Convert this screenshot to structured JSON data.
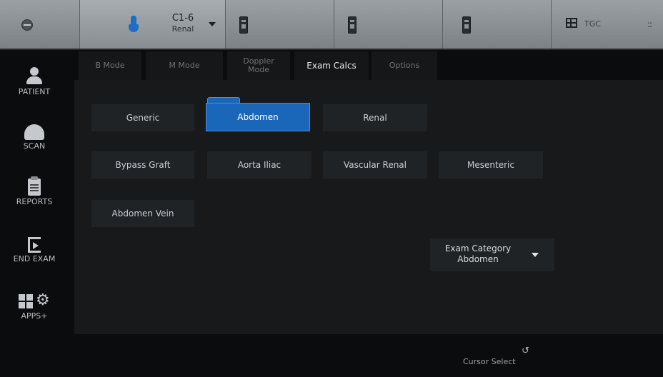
{
  "topbar": {
    "probe": {
      "name": "C1-6",
      "preset": "Renal"
    },
    "tgc_label": "TGC",
    "expand_glyph": "::"
  },
  "rail": {
    "items": [
      {
        "label": "PATIENT",
        "icon": "patient-icon"
      },
      {
        "label": "SCAN",
        "icon": "scan-icon"
      },
      {
        "label": "REPORTS",
        "icon": "reports-icon"
      },
      {
        "label": "END EXAM",
        "icon": "end-exam-icon"
      },
      {
        "label": "APPS+",
        "icon": "apps-icon"
      }
    ]
  },
  "tabs": [
    {
      "label": "B Mode"
    },
    {
      "label": "M Mode"
    },
    {
      "label": "Doppler Mode"
    },
    {
      "label": "Exam Calcs",
      "active": true
    },
    {
      "label": "Options"
    }
  ],
  "calcs": {
    "generic": "Generic",
    "abdomen": "Abdomen",
    "renal": "Renal",
    "bypass_graft": "Bypass Graft",
    "aorta_iliac": "Aorta Iliac",
    "vascular_renal": "Vascular Renal",
    "mesenteric": "Mesenteric",
    "abdomen_vein": "Abdomen Vein",
    "selected": "Abdomen"
  },
  "exam_category": {
    "label": "Exam Category",
    "value": "Abdomen"
  },
  "footer": {
    "cursor_select": "Cursor Select"
  },
  "colors": {
    "accent": "#1a66b8",
    "background": "#0b0c0d",
    "panel": "#17191b",
    "button": "#202326"
  }
}
